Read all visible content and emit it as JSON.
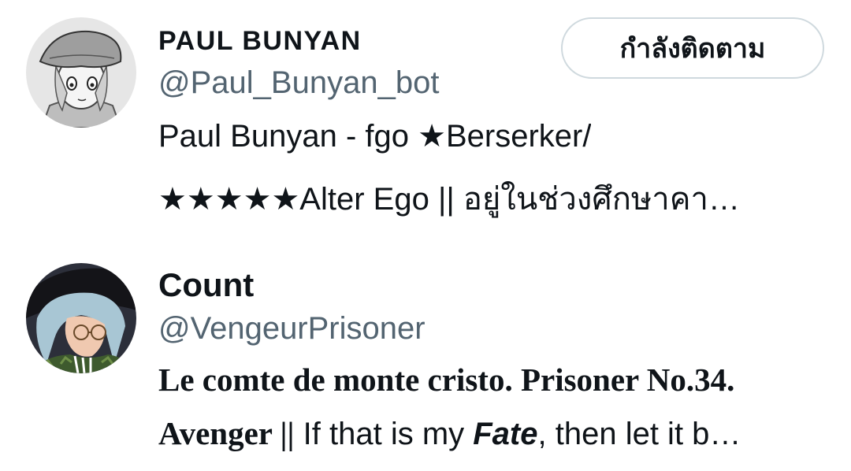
{
  "users": [
    {
      "display_name": "PAUL BUNYAN",
      "handle": "@Paul_Bunyan_bot",
      "follow_button_label": "กำลังติดตาม",
      "bio_line1": "Paul Bunyan - fgo ★Berserker/",
      "bio_line2": "★★★★★Alter Ego || อยู่ในช่วงศึกษาคา…"
    },
    {
      "display_name": "Count",
      "handle": "@VengeurPrisoner",
      "bio_line1": "Le comte de monte cristo. Prisoner No.34.",
      "bio_line2_serif": "Avenger ||",
      "bio_line2_mid": " If that is my ",
      "bio_line2_emph": "Fate",
      "bio_line2_end": ", then let it b…"
    }
  ]
}
